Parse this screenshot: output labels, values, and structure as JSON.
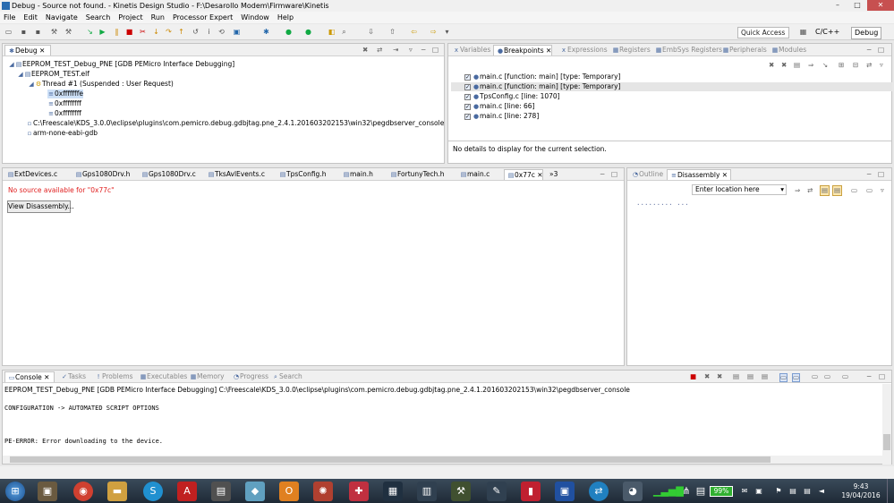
{
  "window": {
    "title": "Debug - Source not found. - Kinetis Design Studio - F:\\Desarollo Modem\\Firmware\\Kinetis",
    "min_label": "–",
    "max_label": "□",
    "close_label": "✕"
  },
  "menu": [
    "File",
    "Edit",
    "Navigate",
    "Search",
    "Project",
    "Run",
    "Processor Expert",
    "Window",
    "Help"
  ],
  "toolbar": {
    "quick_access": "Quick Access",
    "perspectives": [
      "C/C++",
      "Debug"
    ]
  },
  "debug_view": {
    "tab": "Debug",
    "tree": [
      "EEPROM_TEST_Debug_PNE [GDB PEMicro Interface Debugging]",
      "EEPROM_TEST.elf",
      "Thread #1 (Suspended : User Request)",
      "0xfffffffe",
      "0xffffffff",
      "0xffffffff",
      "C:\\Freescale\\KDS_3.0.0\\eclipse\\plugins\\com.pemicro.debug.gdbjtag.pne_2.4.1.201603202153\\win32\\pegdbserver_console",
      "arm-none-eabi-gdb"
    ]
  },
  "right_top": {
    "tabs": [
      "Variables",
      "Breakpoints",
      "Expressions",
      "Registers",
      "EmbSys Registers",
      "Peripherals",
      "Modules"
    ],
    "active_tab": "Breakpoints",
    "breakpoints": [
      "main.c [function: main] [type: Temporary]",
      "main.c [function: main] [type: Temporary]",
      "TpsConfig.c [line: 1070]",
      "main.c [line: 66]",
      "main.c [line: 278]"
    ],
    "details": "No details to display for the current selection."
  },
  "editor": {
    "tabs": [
      "ExtDevices.c",
      "Gps1080Drv.h",
      "Gps1080Drv.c",
      "TksAvlEvents.c",
      "TpsConfig.h",
      "main.h",
      "FortunyTech.h",
      "main.c",
      "0x77c"
    ],
    "overflow": "»3",
    "message": "No source available for \"0x77c\"",
    "button": "View Disassembly..."
  },
  "disassembly": {
    "tabs": [
      "Outline",
      "Disassembly"
    ],
    "location_placeholder": "Enter location here",
    "content": "......... ..."
  },
  "console": {
    "tabs": [
      "Console",
      "Tasks",
      "Problems",
      "Executables",
      "Memory",
      "Progress",
      "Search"
    ],
    "header": "EEPROM_TEST_Debug_PNE [GDB PEMicro Interface Debugging] C:\\Freescale\\KDS_3.0.0\\eclipse\\plugins\\com.pemicro.debug.gdbjtag.pne_2.4.1.201603202153\\win32\\pegdbserver_console",
    "lines": [
      "CONFIGURATION -> AUTOMATED SCRIPT OPTIONS",
      "PE-ERROR: Error downloading to the device."
    ]
  },
  "taskbar": {
    "battery": "99%",
    "time": "9:43",
    "date": "19/04/2016"
  }
}
